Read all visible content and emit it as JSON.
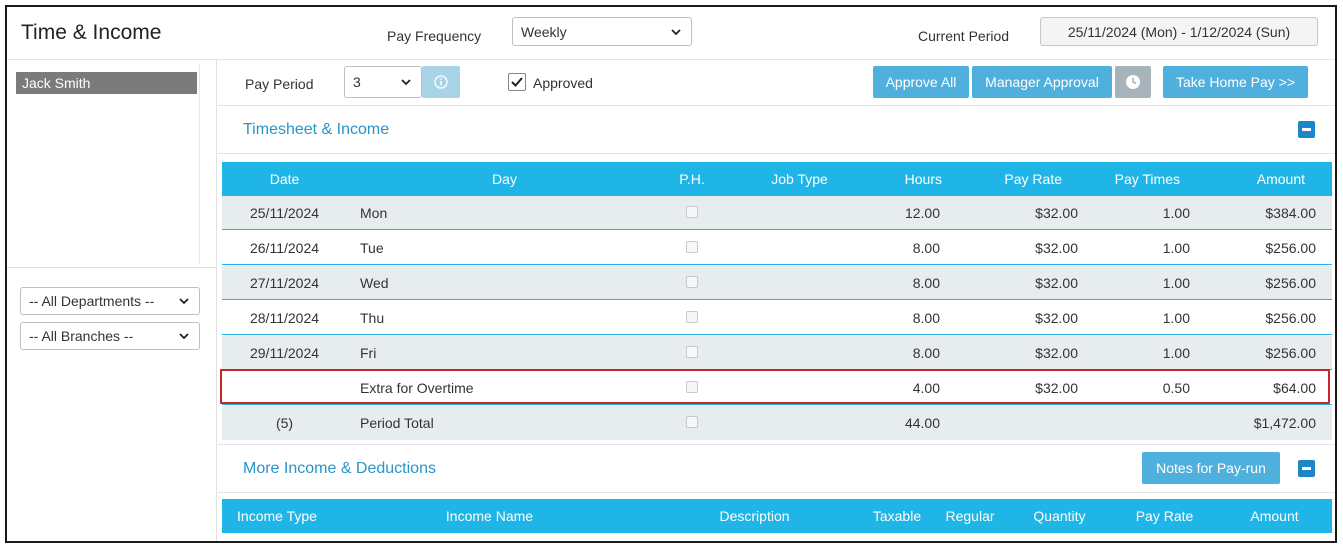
{
  "header": {
    "title": "Time & Income",
    "pay_frequency_label": "Pay Frequency",
    "pay_frequency_value": "Weekly",
    "current_period_label": "Current Period",
    "current_period_value": "25/11/2024 (Mon) - 1/12/2024 (Sun)"
  },
  "sidebar": {
    "employees": [
      "Jack Smith"
    ],
    "department_filter": "-- All Departments --",
    "branch_filter": "-- All Branches --"
  },
  "toolbar": {
    "pay_period_label": "Pay Period",
    "pay_period_value": "3",
    "approved_label": "Approved",
    "approved_checked": true,
    "approve_all": "Approve All",
    "manager_approval": "Manager Approval",
    "take_home_pay": "Take Home Pay >>"
  },
  "timesheet": {
    "title": "Timesheet & Income",
    "columns": [
      "Date",
      "Day",
      "P.H.",
      "Job Type",
      "Hours",
      "Pay Rate",
      "Pay Times",
      "Amount"
    ],
    "rows": [
      {
        "date": "25/11/2024",
        "day": "Mon",
        "hours": "12.00",
        "rate": "$32.00",
        "times": "1.00",
        "amount": "$384.00"
      },
      {
        "date": "26/11/2024",
        "day": "Tue",
        "hours": "8.00",
        "rate": "$32.00",
        "times": "1.00",
        "amount": "$256.00"
      },
      {
        "date": "27/11/2024",
        "day": "Wed",
        "hours": "8.00",
        "rate": "$32.00",
        "times": "1.00",
        "amount": "$256.00"
      },
      {
        "date": "28/11/2024",
        "day": "Thu",
        "hours": "8.00",
        "rate": "$32.00",
        "times": "1.00",
        "amount": "$256.00"
      },
      {
        "date": "29/11/2024",
        "day": "Fri",
        "hours": "8.00",
        "rate": "$32.00",
        "times": "1.00",
        "amount": "$256.00"
      },
      {
        "date": "",
        "day": "Extra for Overtime",
        "hours": "4.00",
        "rate": "$32.00",
        "times": "0.50",
        "amount": "$64.00"
      },
      {
        "date": "(5)",
        "day": "Period Total",
        "hours": "44.00",
        "rate": "",
        "times": "",
        "amount": "$1,472.00"
      }
    ]
  },
  "more_income": {
    "title": "More Income & Deductions",
    "notes_button": "Notes for Pay-run",
    "columns": [
      "Income Type",
      "Income Name",
      "Description",
      "Taxable",
      "Regular",
      "Quantity",
      "Pay Rate",
      "Amount"
    ]
  },
  "colors": {
    "accent": "#1fb5e6",
    "button": "#4fb0de",
    "section_title": "#2a93c9",
    "highlight": "#c9262c"
  }
}
